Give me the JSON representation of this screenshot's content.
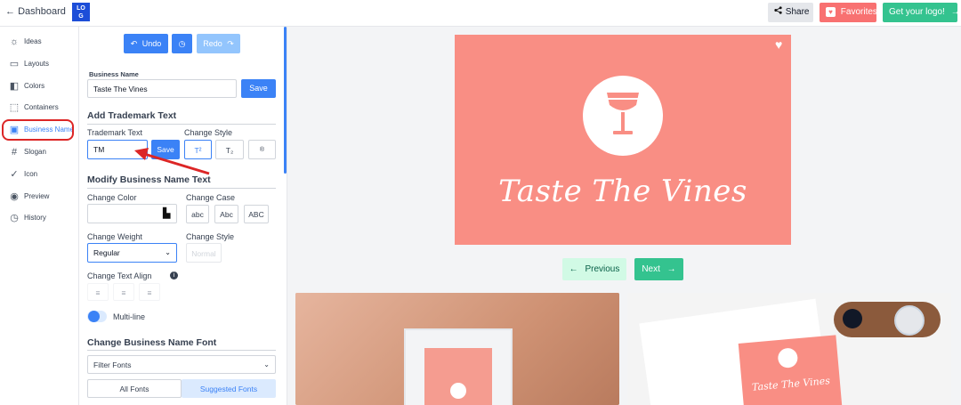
{
  "header": {
    "back_label": "Dashboard",
    "logo_text": "LOGO",
    "share_label": "Share",
    "favorites_label": "Favorites",
    "get_logo_label": "Get your logo!"
  },
  "sidebar": {
    "items": [
      {
        "label": "Ideas",
        "icon": "lightbulb-icon"
      },
      {
        "label": "Layouts",
        "icon": "layouts-icon"
      },
      {
        "label": "Colors",
        "icon": "colors-icon"
      },
      {
        "label": "Containers",
        "icon": "containers-icon"
      },
      {
        "label": "Business Name",
        "icon": "business-name-icon"
      },
      {
        "label": "Slogan",
        "icon": "hash-icon"
      },
      {
        "label": "Icon",
        "icon": "check-circle-icon"
      },
      {
        "label": "Preview",
        "icon": "eye-icon"
      },
      {
        "label": "History",
        "icon": "history-icon"
      }
    ]
  },
  "toolbar": {
    "undo_label": "Undo",
    "redo_label": "Redo"
  },
  "business_name": {
    "label": "Business Name",
    "value": "Taste The Vines",
    "save_label": "Save"
  },
  "trademark": {
    "heading": "Add Trademark Text",
    "text_label": "Trademark Text",
    "text_value": "TM",
    "save_label": "Save",
    "style_label": "Change Style",
    "style_options": [
      "T²",
      "T₂",
      "®"
    ]
  },
  "modify": {
    "heading": "Modify Business Name Text",
    "color_label": "Change Color",
    "case_label": "Change Case",
    "case_options": [
      "abc",
      "Abc",
      "ABC"
    ],
    "weight_label": "Change Weight",
    "weight_value": "Regular",
    "style_label": "Change Style",
    "style_value": "Normal",
    "align_label": "Change Text Align",
    "multiline_label": "Multi-line"
  },
  "font": {
    "heading": "Change Business Name Font",
    "filter_placeholder": "Filter Fonts",
    "tab_all": "All Fonts",
    "tab_suggested": "Suggested Fonts"
  },
  "preview": {
    "brand_text": "Taste The Vines",
    "previous_label": "Previous",
    "next_label": "Next",
    "mock2_text": "Taste The Vines"
  },
  "colors": {
    "accent": "#3b82f6",
    "logo_bg": "#f98e84",
    "favorites": "#f87171",
    "get_logo": "#34c38f",
    "highlight": "#dc2626"
  }
}
